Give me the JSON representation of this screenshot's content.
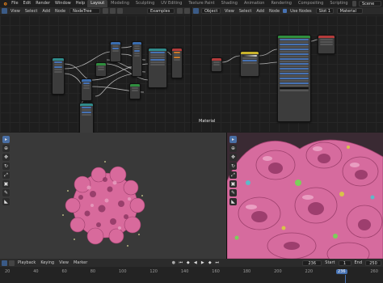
{
  "menus": [
    "File",
    "Edit",
    "Render",
    "Window",
    "Help"
  ],
  "workspaces": [
    "Layout",
    "Modeling",
    "Sculpting",
    "UV Editing",
    "Texture Paint",
    "Shading",
    "Animation",
    "Rendering",
    "Compositing",
    "Scripting"
  ],
  "active_workspace": "Layout",
  "scene_name": "Scene",
  "left_node_editor": {
    "menus": [
      "View",
      "Select",
      "Add",
      "Node"
    ],
    "tree_name": "NodeTree",
    "examples_label": "Examples"
  },
  "right_node_editor": {
    "menus": [
      "View",
      "Select",
      "Add",
      "Node"
    ],
    "object_label": "Object",
    "use_nodes_label": "Use Nodes",
    "slot_label": "Slot 1",
    "material_field": "Material",
    "footer_label": "Material"
  },
  "timeline": {
    "menus": [
      "Playback",
      "Keying",
      "View",
      "Marker"
    ],
    "current_frame": "236",
    "start_label": "Start",
    "start_value": "1",
    "end_label": "End",
    "end_value": "250",
    "ruler_ticks": [
      "20",
      "40",
      "60",
      "80",
      "100",
      "120",
      "140",
      "160",
      "180",
      "200",
      "220",
      "236",
      "260"
    ]
  },
  "colors": {
    "accent_blue": "#4772b3",
    "node_green": "#2f8f3e",
    "node_red": "#b33b3b",
    "node_orange": "#c97a2b",
    "node_teal": "#2f8a8a",
    "object_pink": "#d86a9c"
  }
}
